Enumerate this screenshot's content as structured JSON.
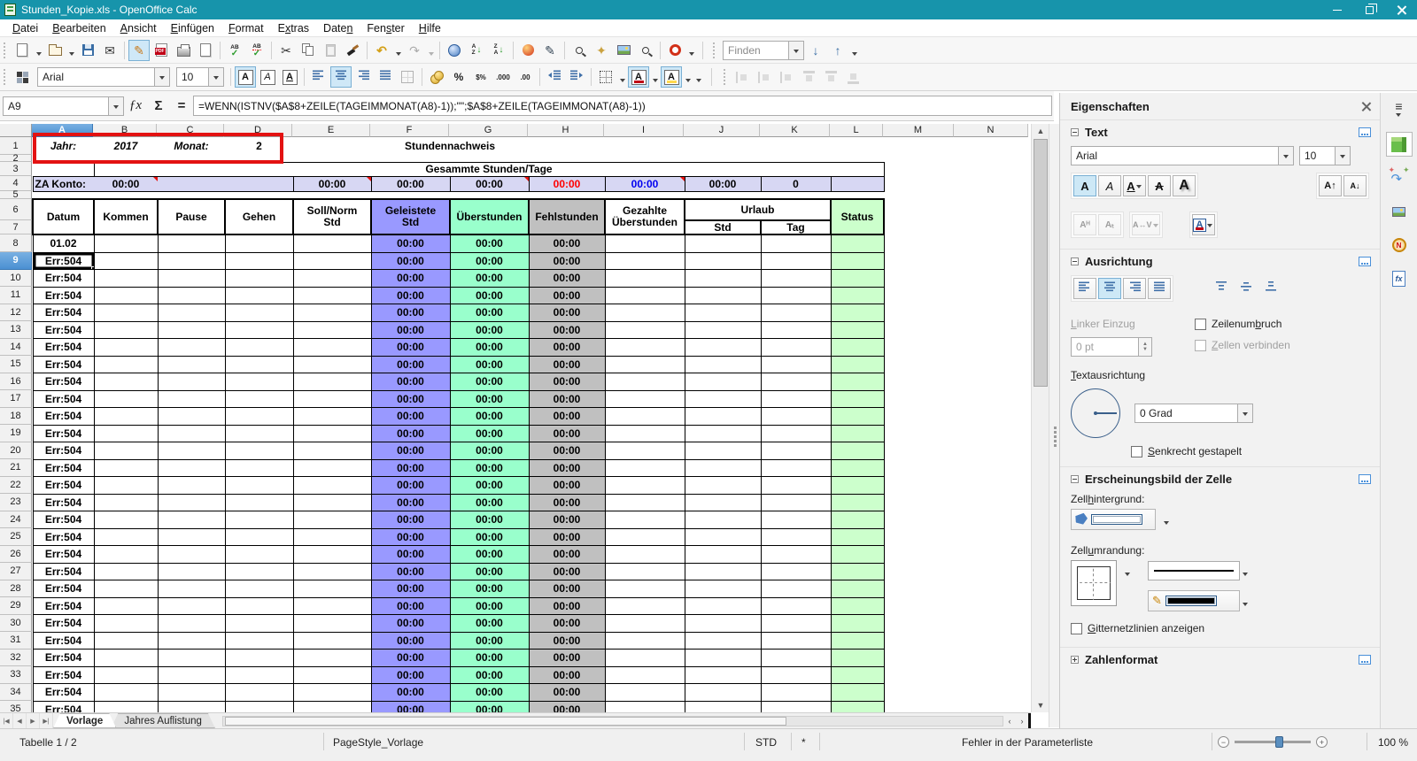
{
  "window": {
    "title": "Stunden_Kopie.xls - OpenOffice Calc",
    "controls": [
      "minimize",
      "restore",
      "close"
    ]
  },
  "menu": {
    "items": [
      {
        "label": "Datei",
        "accel": 0
      },
      {
        "label": "Bearbeiten",
        "accel": 0
      },
      {
        "label": "Ansicht",
        "accel": 0
      },
      {
        "label": "Einfügen",
        "accel": 0
      },
      {
        "label": "Format",
        "accel": 0
      },
      {
        "label": "Extras",
        "accel": 1
      },
      {
        "label": "Daten",
        "accel": 4
      },
      {
        "label": "Fenster",
        "accel": 3
      },
      {
        "label": "Hilfe",
        "accel": 0
      }
    ]
  },
  "toolbar_standard": {
    "icons": [
      "new-document",
      "open",
      "save",
      "email",
      "edit-mode",
      "export-pdf",
      "print",
      "page-preview",
      "spellcheck",
      "auto-spellcheck",
      "cut",
      "copy",
      "paste",
      "format-paintbrush",
      "undo",
      "redo",
      "hyperlink",
      "sort-ascending",
      "sort-descending",
      "insert-chart",
      "show-draw-functions",
      "find-replace",
      "navigator",
      "gallery",
      "zoom",
      "help"
    ],
    "find_value": "Finden"
  },
  "toolbar_formatting": {
    "icons": [
      "styles",
      "font-name",
      "font-size",
      "bold",
      "italic",
      "underline",
      "align-left",
      "align-center",
      "align-right",
      "justify",
      "merge-cells",
      "currency",
      "percent",
      "standard-format",
      "add-decimal",
      "delete-decimal",
      "decrease-indent",
      "increase-indent",
      "borders",
      "font-color",
      "background-color"
    ],
    "font_name": "Arial",
    "font_size": "10",
    "currency_label": "%",
    "standard_label": "$%",
    "add_decimal_label": ".000",
    "delete_decimal_label": ".00"
  },
  "formula_bar": {
    "cell_reference": "A9",
    "fx_label": "ƒx",
    "sum_label": "Σ",
    "equals_label": "=",
    "formula": "=WENN(ISTNV($A$8+ZEILE(TAGEIMMONAT(A8)-1));\"\";$A$8+ZEILE(TAGEIMMONAT(A8)-1))"
  },
  "grid": {
    "columns": [
      [
        "A",
        69
      ],
      [
        "B",
        72
      ],
      [
        "C",
        76
      ],
      [
        "D",
        77
      ],
      [
        "E",
        88
      ],
      [
        "F",
        89
      ],
      [
        "G",
        89
      ],
      [
        "H",
        86
      ],
      [
        "I",
        90
      ],
      [
        "J",
        86
      ],
      [
        "K",
        79
      ],
      [
        "L",
        60
      ],
      [
        "M",
        80
      ],
      [
        "N",
        84
      ]
    ],
    "selected_column": "A",
    "selected_row": 9,
    "row_heights": {
      "1": 20,
      "2": 8,
      "3": 16,
      "4": 17,
      "5": 9,
      "6": 24,
      "7": 16,
      "8": 20,
      "default": 19.5,
      "count": 35
    },
    "cells": {
      "jahr_label": "Jahr:",
      "jahr_value": "2017",
      "monat_label": "Monat:",
      "monat_value": "2",
      "title": "Stundennachweis",
      "summary_header": "Gesammte Stunden/Tage",
      "za_label": "ZA Konto:",
      "za_value": "00:00",
      "summary_values": [
        "00:00",
        "00:00",
        "00:00",
        "00:00",
        "00:00",
        "00:00",
        "0"
      ],
      "summary_colors": [
        "#000000",
        "#000000",
        "#000000",
        "#ff0000",
        "#0000f0",
        "#000000",
        "#000000"
      ],
      "comment_cells": [
        "B",
        "E",
        "G",
        "I"
      ]
    },
    "header": {
      "datum": "Datum",
      "kommen": "Kommen",
      "pause": "Pause",
      "gehen": "Gehen",
      "soll": "Soll/Norm\nStd",
      "geleistete": "Geleistete\nStd",
      "ueberstunden": "Überstunden",
      "fehlstunden": "Fehlstunden",
      "gezahlte": "Gezahlte\nÜberstunden",
      "urlaub": "Urlaub",
      "urlaub_std": "Std",
      "urlaub_tag": "Tag",
      "status": "Status"
    },
    "data_rows": {
      "start": 8,
      "end": 35,
      "datum_first": "01.02",
      "datum_error": "Err:504",
      "geleistete": "00:00",
      "ueberstunden": "00:00",
      "fehlstunden": "00:00"
    }
  },
  "sheet_tabs": {
    "nav": [
      "first-sheet",
      "previous-sheet",
      "next-sheet",
      "last-sheet"
    ],
    "tabs": [
      {
        "label": "Vorlage",
        "active": true
      },
      {
        "label": "Jahres Auflistung",
        "active": false
      }
    ]
  },
  "status_bar": {
    "sheet_info": "Tabelle 1 / 2",
    "page_style": "PageStyle_Vorlage",
    "mode": "STD",
    "modified_flag": "*",
    "message": "Fehler in der Parameterliste",
    "zoom_level": "100 %"
  },
  "sidebar": {
    "title": "Eigenschaften",
    "text_section": {
      "title": "Text",
      "font_name": "Arial",
      "font_size": "10"
    },
    "alignment_section": {
      "title": "Ausrichtung",
      "indent_label": "Linker Einzug",
      "indent_value": "0 pt",
      "wrap_label": "Zeilenumbruch",
      "merge_label": "Zellen verbinden",
      "orientation_label": "Textausrichtung",
      "rotation_value": "0 Grad",
      "stacked_label": "Senkrecht gestapelt"
    },
    "cell_section": {
      "title": "Erscheinungsbild der Zelle",
      "bg_label": "Zellhintergrund:",
      "border_label": "Zellumrandung:",
      "grid_label": "Gitternetzlinien anzeigen"
    },
    "number_section": {
      "title": "Zahlenformat"
    },
    "tab_icons": [
      "sidebar-menu",
      "properties",
      "styles",
      "gallery",
      "navigator",
      "functions"
    ]
  },
  "colors": {
    "titlebar_teal": "#1794ab",
    "geleistete_bg": "#9999ff",
    "ueberstunden_bg": "#99ffcc",
    "fehlstunden_bg": "#c0c0c0",
    "status_bg": "#ccffcc",
    "summary_bg": "#d7d7f3",
    "selection_blue": "#4b90d2",
    "annotation_red": "#e31212",
    "error_red": "#ff0000",
    "value_blue": "#0000f0",
    "za_green": "#46a400"
  }
}
